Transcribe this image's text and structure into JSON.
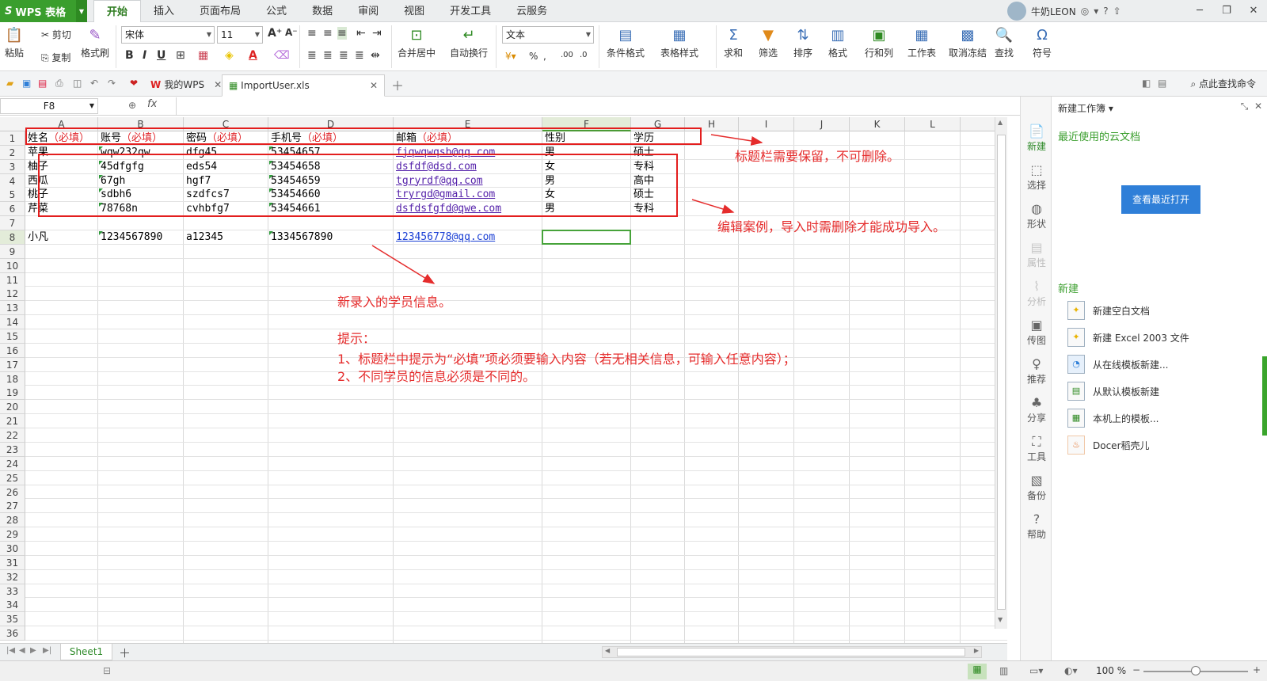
{
  "app": {
    "name": "WPS 表格",
    "logo": "S",
    "user": "牛奶LEON"
  },
  "menu_tabs": [
    "开始",
    "插入",
    "页面布局",
    "公式",
    "数据",
    "审阅",
    "视图",
    "开发工具",
    "云服务"
  ],
  "ribbon": {
    "paste": "粘贴",
    "cut": "剪切",
    "copy": "复制",
    "format_painter": "格式刷",
    "font_name": "宋体",
    "font_size": "11",
    "merge_center": "合并居中",
    "wrap_text": "自动换行",
    "number_format": "文本",
    "cond_format": "条件格式",
    "table_style": "表格样式",
    "sum": "求和",
    "filter": "筛选",
    "sort": "排序",
    "format": "格式",
    "row_col": "行和列",
    "worksheet": "工作表",
    "freeze": "取消冻结",
    "find": "查找",
    "symbol": "符号"
  },
  "doc_tabs": [
    {
      "label": "我的WPS"
    },
    {
      "label": "ImportUser.xls"
    }
  ],
  "find_command": "点此查找命令",
  "formula_bar": {
    "cell_ref": "F8",
    "fx": "fx",
    "value": ""
  },
  "columns": [
    "A",
    "B",
    "C",
    "D",
    "E",
    "F",
    "G",
    "H",
    "I",
    "J",
    "K",
    "L"
  ],
  "rows": [
    "1",
    "2",
    "3",
    "4",
    "5",
    "6",
    "7",
    "8",
    "9",
    "10",
    "11",
    "12",
    "13",
    "14",
    "15",
    "16",
    "17",
    "18",
    "19",
    "20",
    "21",
    "22",
    "23",
    "24",
    "25",
    "26",
    "27",
    "28",
    "29",
    "30",
    "31",
    "32",
    "33",
    "34",
    "35",
    "36"
  ],
  "header_row": [
    {
      "text": "姓名",
      "req": "（必填）"
    },
    {
      "text": "账号",
      "req": "（必填）"
    },
    {
      "text": "密码",
      "req": "（必填）"
    },
    {
      "text": "手机号",
      "req": "（必填）"
    },
    {
      "text": "邮箱",
      "req": "（必填）"
    },
    {
      "text": "性别",
      "req": ""
    },
    {
      "text": "学历",
      "req": ""
    }
  ],
  "data_rows": [
    [
      "苹果",
      "wqw232qw",
      "dfg45",
      "53454657",
      "fjqwqwqsb@qq.com",
      "男",
      "硕士"
    ],
    [
      "柚子",
      "45dfgfg",
      "eds54",
      "53454658",
      "dsfdf@dsd.com",
      "女",
      "专科"
    ],
    [
      "西瓜",
      "67gh",
      "hgf7",
      "53454659",
      "tgryrdf@qq.com",
      "男",
      "高中"
    ],
    [
      "桃子",
      "sdbh6",
      "szdfcs7",
      "53454660",
      "tryrgd@gmail.com",
      "女",
      "硕士"
    ],
    [
      "芹菜",
      "78768n",
      "cvhbfg7",
      "53454661",
      "dsfdsfgfd@qwe.com",
      "男",
      "专科"
    ]
  ],
  "new_row": [
    "小凡",
    "1234567890",
    "a12345",
    "1334567890",
    "123456778@qq.com",
    "",
    ""
  ],
  "annotations": {
    "header_note": "标题栏需要保留，不可删除。",
    "example_note": "编辑案例，导入时需删除才能成功导入。",
    "new_note": "新录入的学员信息。",
    "tips_title": "提示：",
    "tip1": "1、标题栏中提示为“必填”项必须要输入内容（若无相关信息，可输入任意内容）；",
    "tip2": "2、不同学员的信息必须是不同的。"
  },
  "sheet_tab": "Sheet1",
  "zoom": "100 %",
  "sidebar": [
    "新建",
    "选择",
    "形状",
    "属性",
    "分析",
    "传图",
    "推荐",
    "分享",
    "工具",
    "备份",
    "帮助"
  ],
  "panel": {
    "title": "新建工作簿",
    "cloud_heading": "最近使用的云文档",
    "open_recent": "查看最近打开",
    "new_heading": "新建",
    "items": [
      "新建空白文档",
      "新建 Excel 2003 文件",
      "从在线模板新建...",
      "从默认模板新建",
      "本机上的模板...",
      "Docer稻壳儿"
    ]
  },
  "colors": {
    "accent": "#3a9e2d",
    "annotation": "#e52c2c",
    "required": "#e0262b"
  }
}
